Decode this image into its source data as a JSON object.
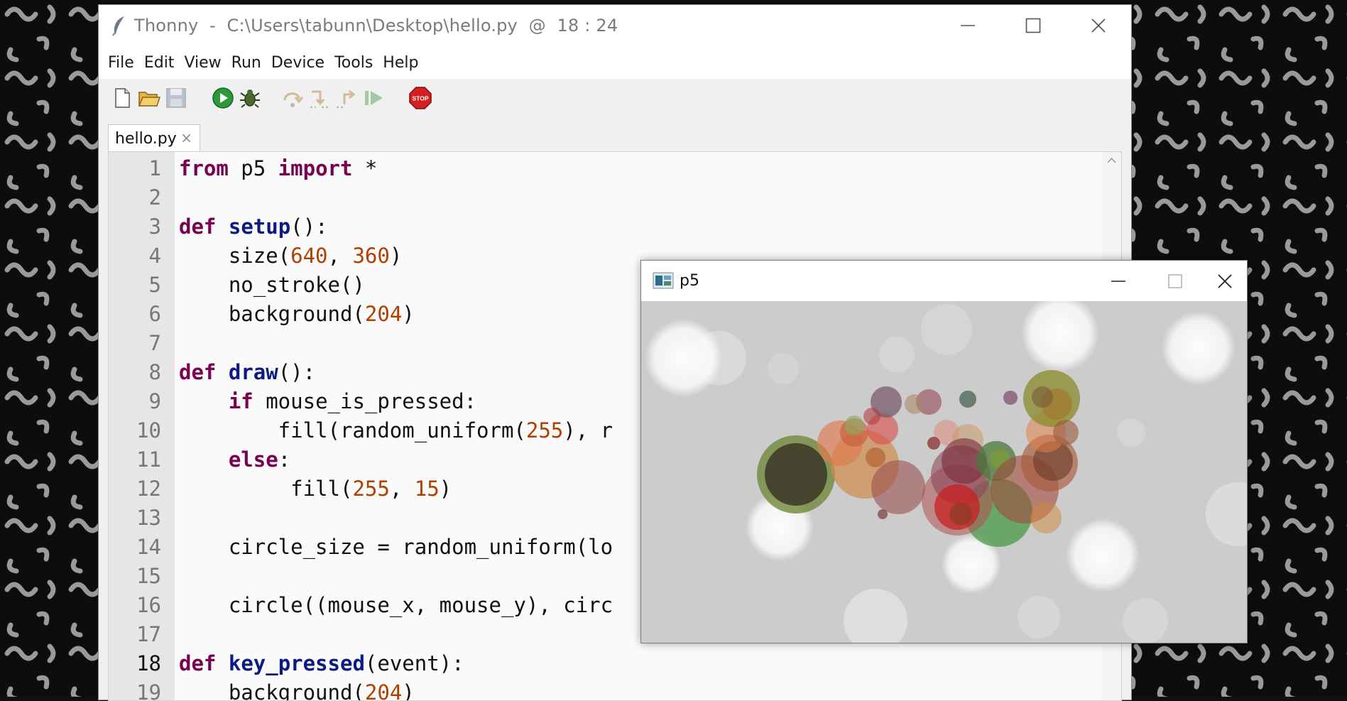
{
  "window": {
    "title": "Thonny  -  C:\\Users\\tabunn\\Desktop\\hello.py  @  18 : 24"
  },
  "menu": [
    "File",
    "Edit",
    "View",
    "Run",
    "Device",
    "Tools",
    "Help"
  ],
  "toolbar": [
    "new-file-icon",
    "open-folder-icon",
    "save-icon",
    "run-icon",
    "debug-bug-icon",
    "step-over-icon",
    "step-into-icon",
    "step-out-icon",
    "resume-icon",
    "stop-icon"
  ],
  "tab": {
    "label": "hello.py",
    "close": "×"
  },
  "editor": {
    "current_line": "18",
    "lines": [
      {
        "n": "1",
        "t": [
          [
            "kw",
            "from"
          ],
          [
            "plain",
            " p5 "
          ],
          [
            "kw",
            "import"
          ],
          [
            "plain",
            " *"
          ]
        ]
      },
      {
        "n": "2",
        "t": []
      },
      {
        "n": "3",
        "t": [
          [
            "kw",
            "def"
          ],
          [
            "plain",
            " "
          ],
          [
            "fn",
            "setup"
          ],
          [
            "plain",
            "():"
          ]
        ]
      },
      {
        "n": "4",
        "t": [
          [
            "plain",
            "    size("
          ],
          [
            "num",
            "640"
          ],
          [
            "plain",
            ", "
          ],
          [
            "num",
            "360"
          ],
          [
            "plain",
            ")"
          ]
        ]
      },
      {
        "n": "5",
        "t": [
          [
            "plain",
            "    no_stroke()"
          ]
        ]
      },
      {
        "n": "6",
        "t": [
          [
            "plain",
            "    background("
          ],
          [
            "num",
            "204"
          ],
          [
            "plain",
            ")"
          ]
        ]
      },
      {
        "n": "7",
        "t": []
      },
      {
        "n": "8",
        "t": [
          [
            "kw",
            "def"
          ],
          [
            "plain",
            " "
          ],
          [
            "fn",
            "draw"
          ],
          [
            "plain",
            "():"
          ]
        ]
      },
      {
        "n": "9",
        "t": [
          [
            "plain",
            "    "
          ],
          [
            "kw",
            "if"
          ],
          [
            "plain",
            " mouse_is_pressed:"
          ]
        ]
      },
      {
        "n": "10",
        "t": [
          [
            "plain",
            "        fill(random_uniform("
          ],
          [
            "num",
            "255"
          ],
          [
            "plain",
            "), r"
          ]
        ]
      },
      {
        "n": "11",
        "t": [
          [
            "plain",
            "    "
          ],
          [
            "kw",
            "else"
          ],
          [
            "plain",
            ":"
          ]
        ]
      },
      {
        "n": "12",
        "t": [
          [
            "plain",
            "         fill("
          ],
          [
            "num",
            "255"
          ],
          [
            "plain",
            ", "
          ],
          [
            "num",
            "15"
          ],
          [
            "plain",
            ")"
          ]
        ]
      },
      {
        "n": "13",
        "t": []
      },
      {
        "n": "14",
        "t": [
          [
            "plain",
            "    circle_size = random_uniform(lo"
          ]
        ]
      },
      {
        "n": "15",
        "t": []
      },
      {
        "n": "16",
        "t": [
          [
            "plain",
            "    circle((mouse_x, mouse_y), circ"
          ]
        ]
      },
      {
        "n": "17",
        "t": []
      },
      {
        "n": "18",
        "t": [
          [
            "kw",
            "def"
          ],
          [
            "plain",
            " "
          ],
          [
            "fn",
            "key_pressed"
          ],
          [
            "plain",
            "(event):"
          ]
        ]
      },
      {
        "n": "19",
        "t": [
          [
            "plain",
            "    background("
          ],
          [
            "num",
            "204"
          ],
          [
            "plain",
            ")"
          ]
        ]
      }
    ]
  },
  "p5_window": {
    "title": "p5"
  },
  "colors": {
    "keyword": "#7a0050",
    "function_name": "#0c1a82",
    "number": "#b04000",
    "canvas_bg": "#cccccc"
  }
}
